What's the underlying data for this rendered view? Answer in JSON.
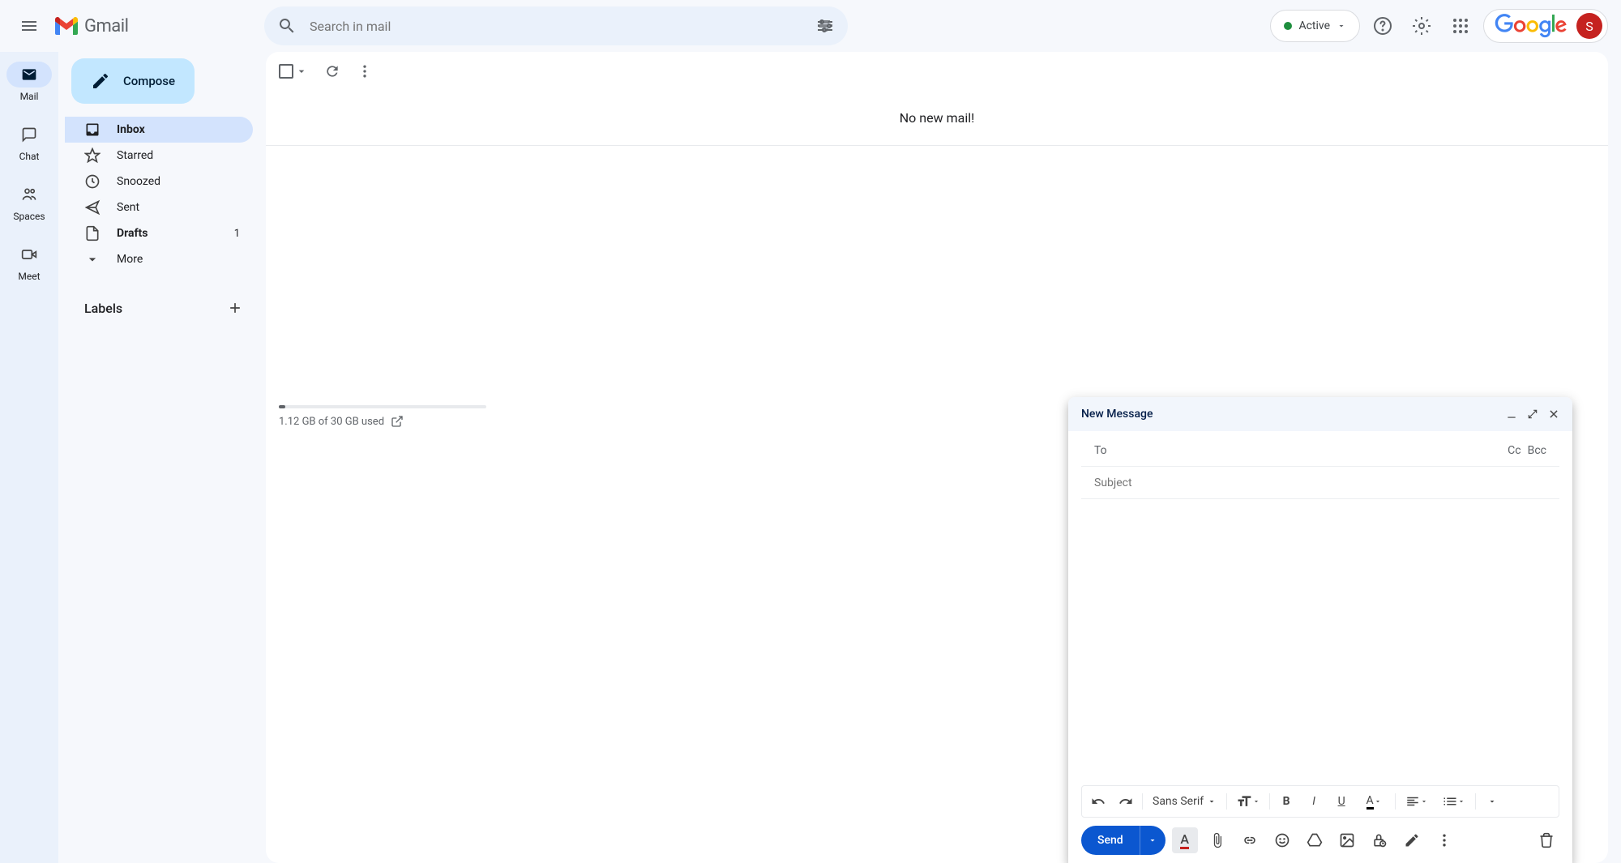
{
  "header": {
    "app_name": "Gmail",
    "search_placeholder": "Search in mail",
    "status_label": "Active",
    "google_wordmark": "Google",
    "avatar_initial": "S"
  },
  "app_rail": [
    {
      "label": "Mail",
      "active": true
    },
    {
      "label": "Chat",
      "active": false
    },
    {
      "label": "Spaces",
      "active": false
    },
    {
      "label": "Meet",
      "active": false
    }
  ],
  "sidebar": {
    "compose_label": "Compose",
    "items": [
      {
        "label": "Inbox",
        "icon": "inbox",
        "selected": true,
        "bold": true,
        "count": ""
      },
      {
        "label": "Starred",
        "icon": "star",
        "selected": false,
        "bold": false,
        "count": ""
      },
      {
        "label": "Snoozed",
        "icon": "clock",
        "selected": false,
        "bold": false,
        "count": ""
      },
      {
        "label": "Sent",
        "icon": "send",
        "selected": false,
        "bold": false,
        "count": ""
      },
      {
        "label": "Drafts",
        "icon": "draft",
        "selected": false,
        "bold": true,
        "count": "1"
      },
      {
        "label": "More",
        "icon": "expand",
        "selected": false,
        "bold": false,
        "count": ""
      }
    ],
    "labels_heading": "Labels"
  },
  "main": {
    "empty_message": "No new mail!",
    "storage_text": "1.12 GB of 30 GB used"
  },
  "compose": {
    "title": "New Message",
    "to_label": "To",
    "cc_label": "Cc",
    "bcc_label": "Bcc",
    "subject_placeholder": "Subject",
    "font_label": "Sans Serif",
    "send_label": "Send"
  }
}
